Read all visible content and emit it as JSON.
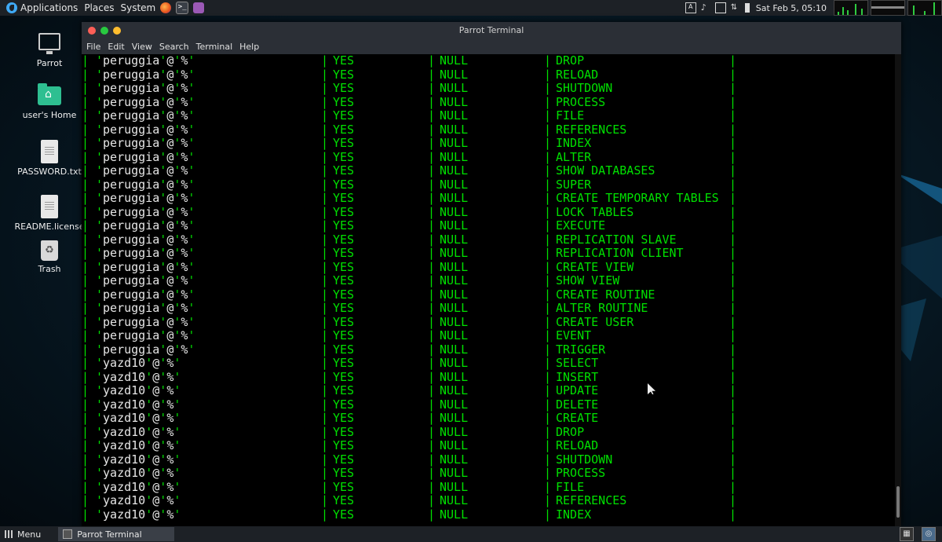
{
  "top_panel": {
    "applications": "Applications",
    "places": "Places",
    "system": "System",
    "clock": "Sat Feb 5, 05:10"
  },
  "desktop_icons": [
    {
      "label": "Parrot",
      "icon": "monitor-icon"
    },
    {
      "label": "user's Home",
      "icon": "home-folder-icon"
    },
    {
      "label": "PASSWORD.txt",
      "icon": "text-file-icon"
    },
    {
      "label": "README.license",
      "icon": "text-file-icon"
    },
    {
      "label": "Trash",
      "icon": "trash-icon"
    }
  ],
  "window": {
    "title": "Parrot Terminal",
    "menu": [
      "File",
      "Edit",
      "View",
      "Search",
      "Terminal",
      "Help"
    ]
  },
  "terminal_rows": [
    {
      "user": "peruggia",
      "grantable": "YES",
      "role": "NULL",
      "privilege": "DROP"
    },
    {
      "user": "peruggia",
      "grantable": "YES",
      "role": "NULL",
      "privilege": "RELOAD"
    },
    {
      "user": "peruggia",
      "grantable": "YES",
      "role": "NULL",
      "privilege": "SHUTDOWN"
    },
    {
      "user": "peruggia",
      "grantable": "YES",
      "role": "NULL",
      "privilege": "PROCESS"
    },
    {
      "user": "peruggia",
      "grantable": "YES",
      "role": "NULL",
      "privilege": "FILE"
    },
    {
      "user": "peruggia",
      "grantable": "YES",
      "role": "NULL",
      "privilege": "REFERENCES"
    },
    {
      "user": "peruggia",
      "grantable": "YES",
      "role": "NULL",
      "privilege": "INDEX"
    },
    {
      "user": "peruggia",
      "grantable": "YES",
      "role": "NULL",
      "privilege": "ALTER"
    },
    {
      "user": "peruggia",
      "grantable": "YES",
      "role": "NULL",
      "privilege": "SHOW DATABASES"
    },
    {
      "user": "peruggia",
      "grantable": "YES",
      "role": "NULL",
      "privilege": "SUPER"
    },
    {
      "user": "peruggia",
      "grantable": "YES",
      "role": "NULL",
      "privilege": "CREATE TEMPORARY TABLES"
    },
    {
      "user": "peruggia",
      "grantable": "YES",
      "role": "NULL",
      "privilege": "LOCK TABLES"
    },
    {
      "user": "peruggia",
      "grantable": "YES",
      "role": "NULL",
      "privilege": "EXECUTE"
    },
    {
      "user": "peruggia",
      "grantable": "YES",
      "role": "NULL",
      "privilege": "REPLICATION SLAVE"
    },
    {
      "user": "peruggia",
      "grantable": "YES",
      "role": "NULL",
      "privilege": "REPLICATION CLIENT"
    },
    {
      "user": "peruggia",
      "grantable": "YES",
      "role": "NULL",
      "privilege": "CREATE VIEW"
    },
    {
      "user": "peruggia",
      "grantable": "YES",
      "role": "NULL",
      "privilege": "SHOW VIEW"
    },
    {
      "user": "peruggia",
      "grantable": "YES",
      "role": "NULL",
      "privilege": "CREATE ROUTINE"
    },
    {
      "user": "peruggia",
      "grantable": "YES",
      "role": "NULL",
      "privilege": "ALTER ROUTINE"
    },
    {
      "user": "peruggia",
      "grantable": "YES",
      "role": "NULL",
      "privilege": "CREATE USER"
    },
    {
      "user": "peruggia",
      "grantable": "YES",
      "role": "NULL",
      "privilege": "EVENT"
    },
    {
      "user": "peruggia",
      "grantable": "YES",
      "role": "NULL",
      "privilege": "TRIGGER"
    },
    {
      "user": "yazd10",
      "grantable": "YES",
      "role": "NULL",
      "privilege": "SELECT"
    },
    {
      "user": "yazd10",
      "grantable": "YES",
      "role": "NULL",
      "privilege": "INSERT"
    },
    {
      "user": "yazd10",
      "grantable": "YES",
      "role": "NULL",
      "privilege": "UPDATE"
    },
    {
      "user": "yazd10",
      "grantable": "YES",
      "role": "NULL",
      "privilege": "DELETE"
    },
    {
      "user": "yazd10",
      "grantable": "YES",
      "role": "NULL",
      "privilege": "CREATE"
    },
    {
      "user": "yazd10",
      "grantable": "YES",
      "role": "NULL",
      "privilege": "DROP"
    },
    {
      "user": "yazd10",
      "grantable": "YES",
      "role": "NULL",
      "privilege": "RELOAD"
    },
    {
      "user": "yazd10",
      "grantable": "YES",
      "role": "NULL",
      "privilege": "SHUTDOWN"
    },
    {
      "user": "yazd10",
      "grantable": "YES",
      "role": "NULL",
      "privilege": "PROCESS"
    },
    {
      "user": "yazd10",
      "grantable": "YES",
      "role": "NULL",
      "privilege": "FILE"
    },
    {
      "user": "yazd10",
      "grantable": "YES",
      "role": "NULL",
      "privilege": "REFERENCES"
    },
    {
      "user": "yazd10",
      "grantable": "YES",
      "role": "NULL",
      "privilege": "INDEX"
    }
  ],
  "bottom_panel": {
    "menu": "Menu",
    "task": "Parrot Terminal"
  },
  "colors": {
    "terminal_text": "#00e000",
    "terminal_bg": "#000000",
    "panel_bg": "#1d2126"
  }
}
